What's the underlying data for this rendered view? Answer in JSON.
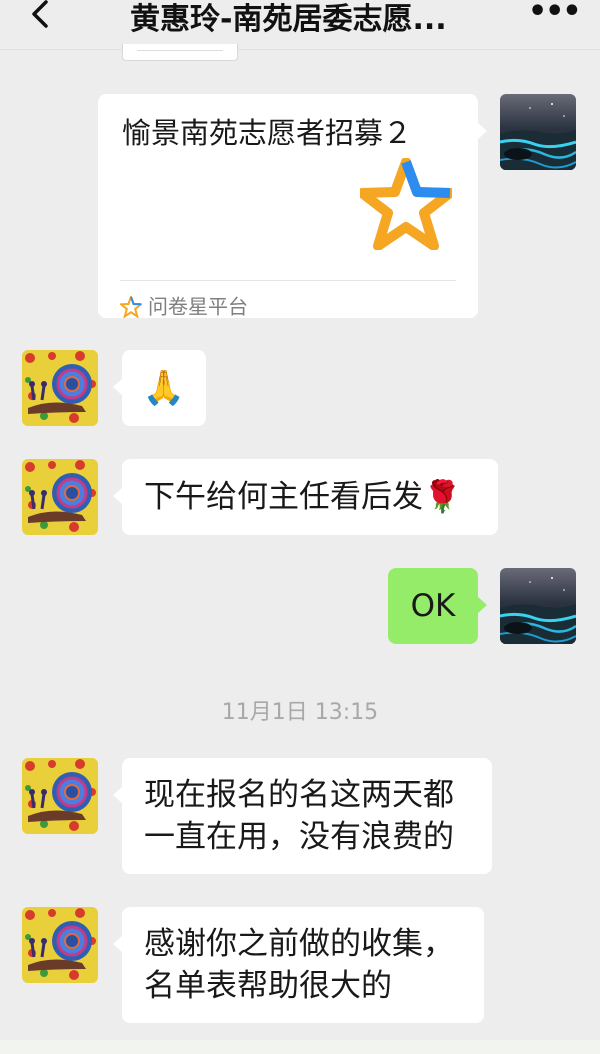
{
  "header": {
    "back_icon": "chevron-left-icon",
    "title": "黄惠玲-南苑居委志愿...",
    "more_icon": "more-dots-icon"
  },
  "messages": [
    {
      "side": "right",
      "type": "card",
      "title": "愉景南苑志愿者招募２",
      "source": "问卷星平台",
      "thumbnail_icon": "wenjuanxing-star-logo",
      "avatar": "night-shore-avatar"
    },
    {
      "side": "left",
      "type": "emoji",
      "text": "🙏",
      "avatar": "snail-painting-avatar"
    },
    {
      "side": "left",
      "type": "text",
      "text": "下午给何主任看后发",
      "trailing_emoji": "🌹",
      "avatar": "snail-painting-avatar"
    },
    {
      "side": "right",
      "type": "text",
      "text": "OK",
      "avatar": "night-shore-avatar"
    },
    {
      "side": "left",
      "type": "text",
      "lines": [
        "现在报名的名这两天都",
        "一直在用，没有浪费的"
      ],
      "avatar": "snail-painting-avatar"
    },
    {
      "side": "left",
      "type": "text",
      "lines": [
        "感谢你之前做的收集，",
        "名单表帮助很大的"
      ],
      "avatar": "snail-painting-avatar"
    }
  ],
  "timestamp": "11月1日 13:15",
  "colors": {
    "background": "#ededed",
    "incoming_bubble": "#ffffff",
    "outgoing_bubble": "#95ec69",
    "timestamp_text": "#a8a8a8"
  }
}
